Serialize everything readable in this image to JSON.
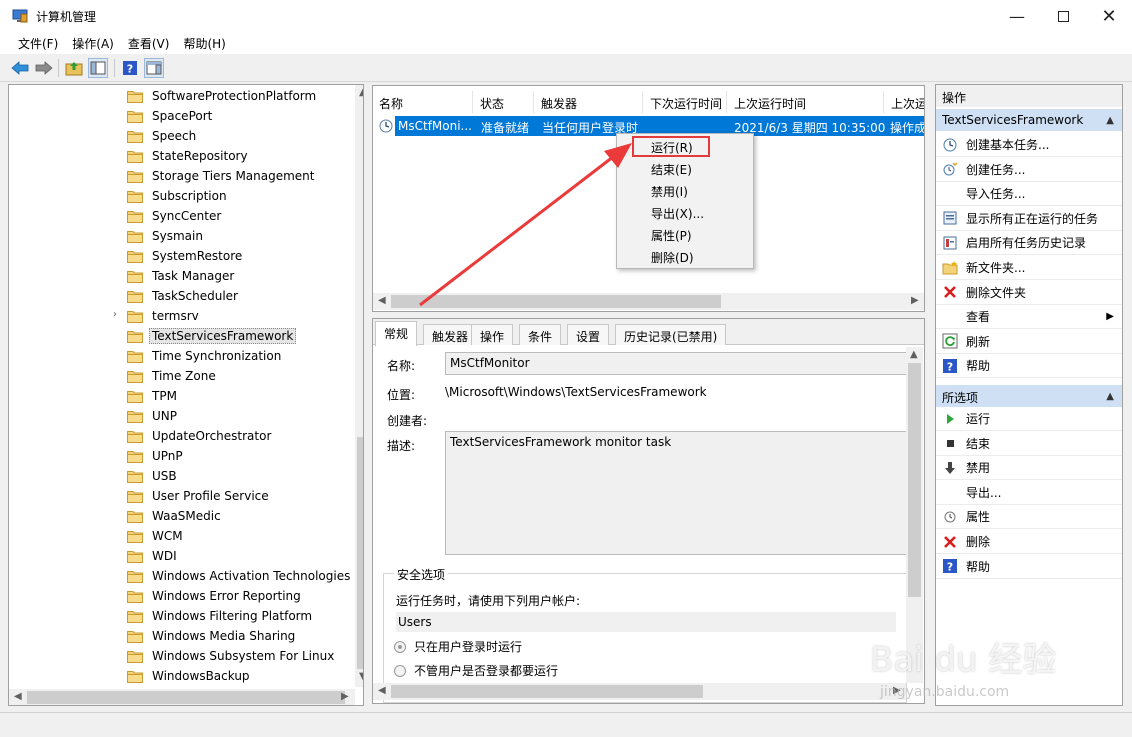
{
  "window": {
    "title": "计算机管理"
  },
  "menu": [
    "文件(F)",
    "操作(A)",
    "查看(V)",
    "帮助(H)"
  ],
  "tree": {
    "items": [
      "SoftwareProtectionPlatform",
      "SpacePort",
      "Speech",
      "StateRepository",
      "Storage Tiers Management",
      "Subscription",
      "SyncCenter",
      "Sysmain",
      "SystemRestore",
      "Task Manager",
      "TaskScheduler",
      "termsrv",
      "TextServicesFramework",
      "Time Synchronization",
      "Time Zone",
      "TPM",
      "UNP",
      "UpdateOrchestrator",
      "UPnP",
      "USB",
      "User Profile Service",
      "WaaSMedic",
      "WCM",
      "WDI",
      "Windows Activation Technologies",
      "Windows Error Reporting",
      "Windows Filtering Platform",
      "Windows Media Sharing",
      "Windows Subsystem For Linux",
      "WindowsBackup"
    ],
    "selected": "TextServicesFramework"
  },
  "tasklist": {
    "columns": [
      "名称",
      "状态",
      "触发器",
      "下次运行时间",
      "上次运行时间",
      "上次运"
    ],
    "row": {
      "name": "MsCtfMoni...",
      "status": "准备就绪",
      "trigger": "当任何用户登录时",
      "next_run": "",
      "last_run": "2021/6/3 星期四 10:35:00",
      "last_result": "操作成"
    }
  },
  "context_menu": [
    "运行(R)",
    "结束(E)",
    "禁用(I)",
    "导出(X)...",
    "属性(P)",
    "删除(D)"
  ],
  "details": {
    "tabs": [
      "常规",
      "触发器",
      "操作",
      "条件",
      "设置",
      "历史记录(已禁用)"
    ],
    "name_label": "名称:",
    "name_value": "MsCtfMonitor",
    "location_label": "位置:",
    "location_value": "\\Microsoft\\Windows\\TextServicesFramework",
    "author_label": "创建者:",
    "desc_label": "描述:",
    "desc_value": "TextServicesFramework monitor task",
    "security_title": "安全选项",
    "run_as_text": "运行任务时，请使用下列用户帐户:",
    "user": "Users",
    "radio1": "只在用户登录时运行",
    "radio2": "不管用户是否登录都要运行"
  },
  "actions": {
    "header": "操作",
    "section1": "TextServicesFramework",
    "items1": [
      {
        "label": "创建基本任务...",
        "icon": "create-basic-task-icon"
      },
      {
        "label": "创建任务...",
        "icon": "create-task-icon"
      },
      {
        "label": "导入任务...",
        "icon": ""
      },
      {
        "label": "显示所有正在运行的任务",
        "icon": "running-tasks-icon"
      },
      {
        "label": "启用所有任务历史记录",
        "icon": "history-icon"
      },
      {
        "label": "新文件夹...",
        "icon": "new-folder-icon"
      },
      {
        "label": "删除文件夹",
        "icon": "delete-folder-icon"
      },
      {
        "label": "查看",
        "icon": ""
      },
      {
        "label": "刷新",
        "icon": "refresh-icon"
      },
      {
        "label": "帮助",
        "icon": "help-icon"
      }
    ],
    "section2": "所选项",
    "items2": [
      {
        "label": "运行",
        "icon": "run-icon"
      },
      {
        "label": "结束",
        "icon": "stop-icon"
      },
      {
        "label": "禁用",
        "icon": "disable-icon"
      },
      {
        "label": "导出...",
        "icon": ""
      },
      {
        "label": "属性",
        "icon": "properties-icon"
      },
      {
        "label": "删除",
        "icon": "delete-icon"
      },
      {
        "label": "帮助",
        "icon": "help-icon"
      }
    ]
  },
  "watermark": {
    "main": "Bai du 经验",
    "sub": "jingyan.baidu.com"
  }
}
